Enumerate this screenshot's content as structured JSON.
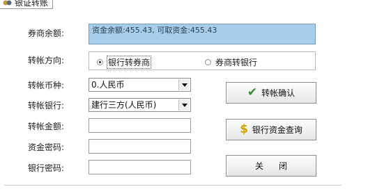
{
  "tab": {
    "label": "银证转账",
    "icon": "money-transfer-icon"
  },
  "form": {
    "broker_balance_label": "券商余额:",
    "broker_balance_value": "资金余额:455.43, 可取资金:455.43",
    "direction_label": "转帐方向:",
    "direction_options": [
      "银行转券商",
      "券商转银行"
    ],
    "direction_selected": "银行转券商",
    "currency_label": "转帐币种:",
    "currency_value": "0.人民币",
    "bank_label": "转帐银行:",
    "bank_value": "建行三方(人民币)",
    "amount_label": "转帐金额:",
    "amount_value": "",
    "fund_password_label": "资金密码:",
    "fund_password_value": "",
    "bank_password_label": "银行密码:",
    "bank_password_value": ""
  },
  "buttons": {
    "confirm": "转帐确认",
    "query": "银行资金查询",
    "close": "关闭"
  },
  "colors": {
    "balance_bg": "#a6cdea",
    "check_green": "#2e8b2e",
    "dollar_gold": "#d4a200"
  }
}
